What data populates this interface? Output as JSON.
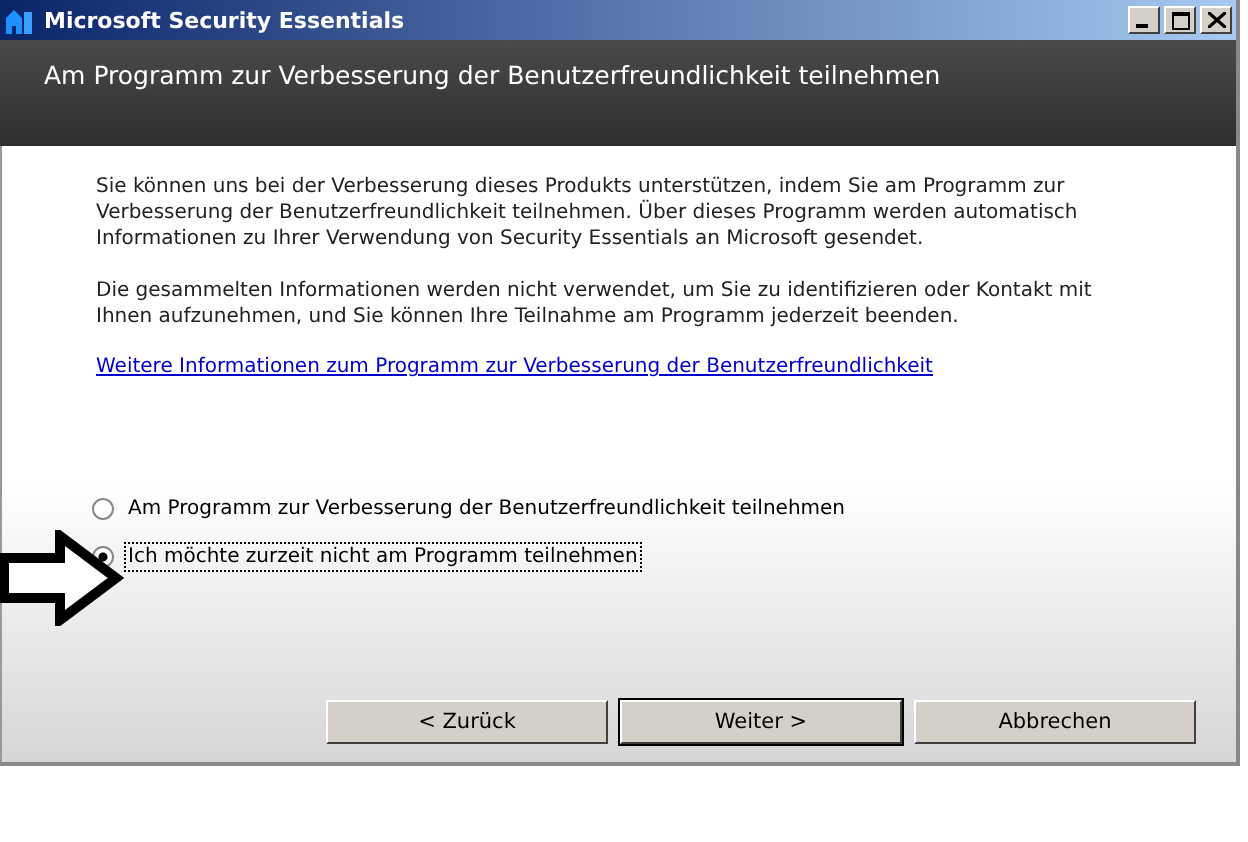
{
  "window": {
    "title": "Microsoft Security Essentials"
  },
  "header": {
    "title": "Am Programm zur Verbesserung der Benutzerfreundlichkeit teilnehmen"
  },
  "paragraphs": [
    "Sie können uns bei der Verbesserung dieses Produkts unterstützen, indem Sie am Programm zur Verbesserung der Benutzerfreundlichkeit teilnehmen. Über dieses Programm werden automatisch Informationen zu Ihrer Verwendung von Security Essentials an Microsoft gesendet.",
    "Die gesammelten Informationen werden nicht verwendet, um Sie zu identifizieren oder Kontakt mit Ihnen aufzunehmen, und Sie können Ihre Teilnahme am Programm jederzeit beenden."
  ],
  "link": "Weitere Informationen zum Programm zur Verbesserung der Benutzerfreundlichkeit",
  "options": [
    {
      "label": "Am Programm zur Verbesserung der Benutzerfreundlichkeit teilnehmen",
      "selected": false
    },
    {
      "label": "Ich möchte zurzeit nicht am Programm teilnehmen",
      "selected": true
    }
  ],
  "buttons": [
    {
      "label": "< Zurück",
      "default": false
    },
    {
      "label": "Weiter >",
      "default": true
    },
    {
      "label": "Abbrechen",
      "default": false
    }
  ]
}
